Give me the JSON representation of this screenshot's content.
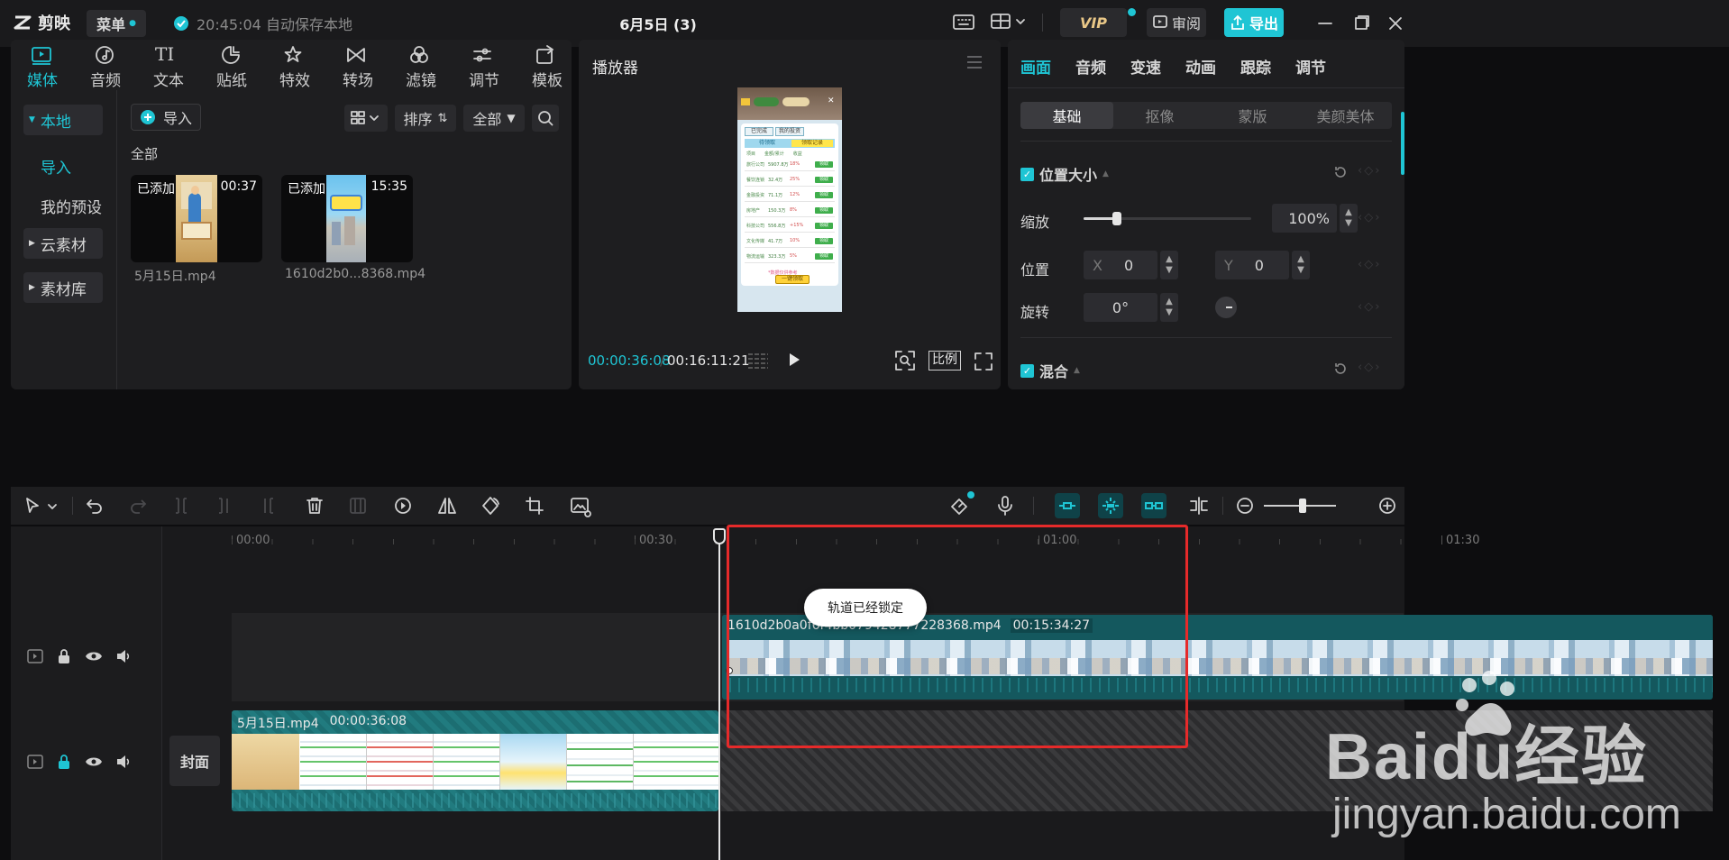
{
  "app": {
    "logo": "剪映",
    "menu_label": "菜单",
    "autosave": "20:45:04 自动保存本地",
    "project_title": "6月5日 (3)",
    "vip": "VIP",
    "review": "审阅",
    "export": "导出"
  },
  "media_tabs": [
    {
      "label": "媒体",
      "icon": "media-icon"
    },
    {
      "label": "音频",
      "icon": "audio-icon"
    },
    {
      "label": "文本",
      "icon": "text-icon"
    },
    {
      "label": "贴纸",
      "icon": "sticker-icon"
    },
    {
      "label": "特效",
      "icon": "effects-icon"
    },
    {
      "label": "转场",
      "icon": "transition-icon"
    },
    {
      "label": "滤镜",
      "icon": "filter-icon"
    },
    {
      "label": "调节",
      "icon": "adjust-icon"
    },
    {
      "label": "模板",
      "icon": "template-icon"
    }
  ],
  "sidebar": {
    "local": "本地",
    "import": "导入",
    "presets": "我的预设",
    "cloud": "云素材",
    "library": "素材库"
  },
  "media_toolbar": {
    "import": "导入",
    "sort": "排序",
    "filter": "全部",
    "section": "全部"
  },
  "clips": [
    {
      "badge": "已添加",
      "duration": "00:37",
      "name": "5月15日.mp4"
    },
    {
      "badge": "已添加",
      "duration": "15:35",
      "name": "1610d2b0...8368.mp4"
    }
  ],
  "player": {
    "title": "播放器",
    "current": "00:00:36:08",
    "total": "00:16:11:21",
    "ratio": "比例"
  },
  "phone": {
    "tabs": [
      "已完成",
      "我的投资"
    ],
    "subtabs": [
      "待领取",
      "领取记录"
    ],
    "headers": [
      "项目",
      "金额/累计",
      "收益"
    ],
    "rows": [
      {
        "name": "旅行公司",
        "amount": "5907.8万",
        "rate": "18%",
        "btn": "领取"
      },
      {
        "name": "餐饮连锁",
        "amount": "32.4万",
        "rate": "25%",
        "btn": "领取"
      },
      {
        "name": "金融投资",
        "amount": "71.1万",
        "rate": "12%",
        "btn": "领取"
      },
      {
        "name": "房地产",
        "amount": "150.3万",
        "rate": "8%",
        "btn": "领取"
      },
      {
        "name": "科技公司",
        "amount": "556.8万",
        "rate": "+15%",
        "btn": "领取"
      },
      {
        "name": "文化传媒",
        "amount": "41.7万",
        "rate": "10%",
        "btn": "领取"
      },
      {
        "name": "物流运输",
        "amount": "323.3万",
        "rate": "5%",
        "btn": "领取"
      }
    ],
    "footer_note": "*数据仅供参考",
    "footer_btn": "一键领取"
  },
  "inspector": {
    "tabs": [
      "画面",
      "音频",
      "变速",
      "动画",
      "跟踪",
      "调节"
    ],
    "subtabs": [
      "基础",
      "抠像",
      "蒙版",
      "美颜美体"
    ],
    "pos_size": "位置大小",
    "scale_label": "缩放",
    "scale_value": "100%",
    "scale_fraction": 0.2,
    "position_label": "位置",
    "x_label": "X",
    "x_value": "0",
    "y_label": "Y",
    "y_value": "0",
    "rotate_label": "旋转",
    "rotate_value": "0°",
    "blend": "混合"
  },
  "timeline": {
    "ticks": [
      "00:00",
      "00:30",
      "01:00",
      "01:30"
    ],
    "tooltip": "轨道已经锁定",
    "clip1_name": "1610d2b0a0f6f4bb079428777228368.mp4",
    "clip1_dur": "00:15:34:27",
    "clip2_name": "5月15日.mp4",
    "clip2_dur": "00:00:36:08",
    "cover": "封面"
  },
  "watermark": {
    "brand": "Baidu经验",
    "url": "jingyan.baidu.com"
  },
  "colors": {
    "accent": "#1fc5d4",
    "highlight_box": "#e62a2a",
    "clip_teal": "#14585e",
    "clip_main": "#1c6e72"
  }
}
